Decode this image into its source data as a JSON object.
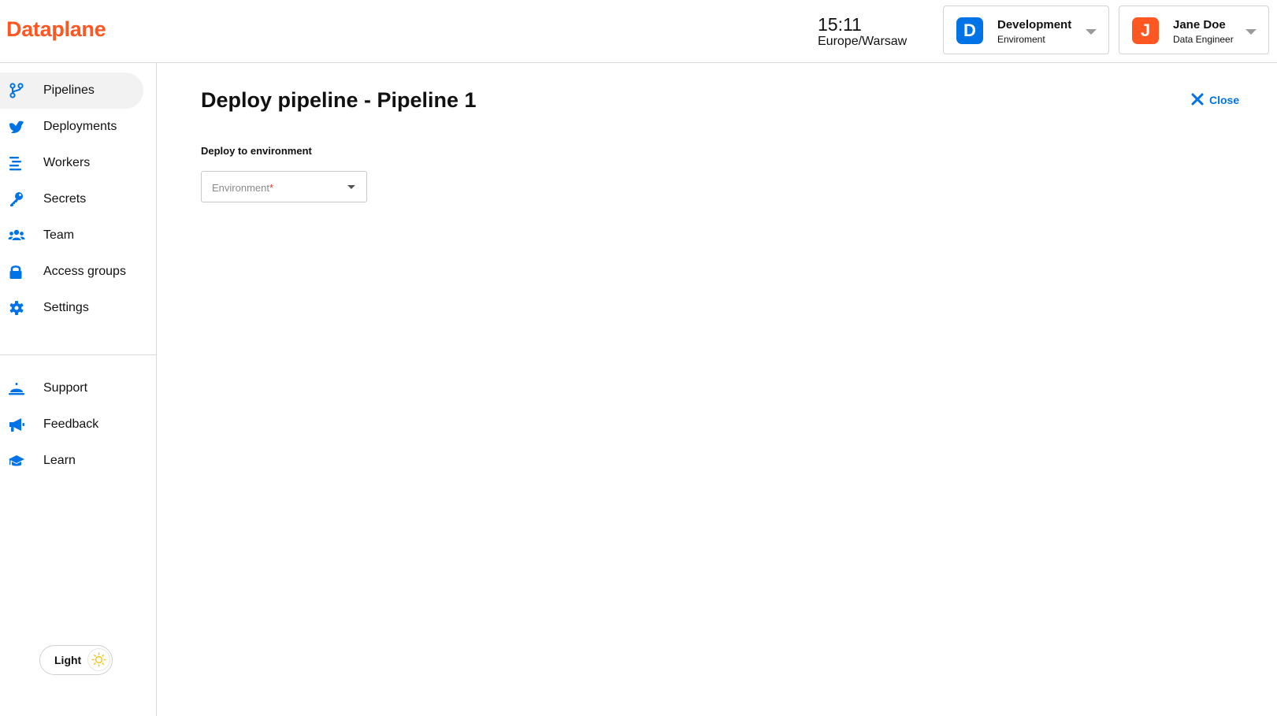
{
  "app": {
    "logo": "Dataplane"
  },
  "header": {
    "time": "15:11",
    "timezone": "Europe/Warsaw",
    "environment": {
      "initial": "D",
      "name": "Development",
      "label": "Enviroment",
      "color": "#0073e6"
    },
    "user": {
      "initial": "J",
      "name": "Jane Doe",
      "role": "Data Engineer",
      "color": "#ff5722"
    }
  },
  "sidebar": {
    "items": [
      {
        "label": "Pipelines",
        "icon": "pipelines-icon",
        "active": true
      },
      {
        "label": "Deployments",
        "icon": "deployments-icon"
      },
      {
        "label": "Workers",
        "icon": "workers-icon"
      },
      {
        "label": "Secrets",
        "icon": "key-icon"
      },
      {
        "label": "Team",
        "icon": "team-icon"
      },
      {
        "label": "Access groups",
        "icon": "lock-icon"
      },
      {
        "label": "Settings",
        "icon": "gear-icon"
      }
    ],
    "secondary": [
      {
        "label": "Support",
        "icon": "bell-icon"
      },
      {
        "label": "Feedback",
        "icon": "megaphone-icon"
      },
      {
        "label": "Learn",
        "icon": "graduation-cap-icon"
      }
    ],
    "theme_label": "Light"
  },
  "main": {
    "title": "Deploy pipeline - Pipeline 1",
    "close_label": "Close",
    "section_label": "Deploy to environment",
    "environment_select": {
      "placeholder": "Environment",
      "required_mark": "*"
    }
  },
  "colors": {
    "accent": "#0073e6",
    "brand": "#ff5722"
  }
}
